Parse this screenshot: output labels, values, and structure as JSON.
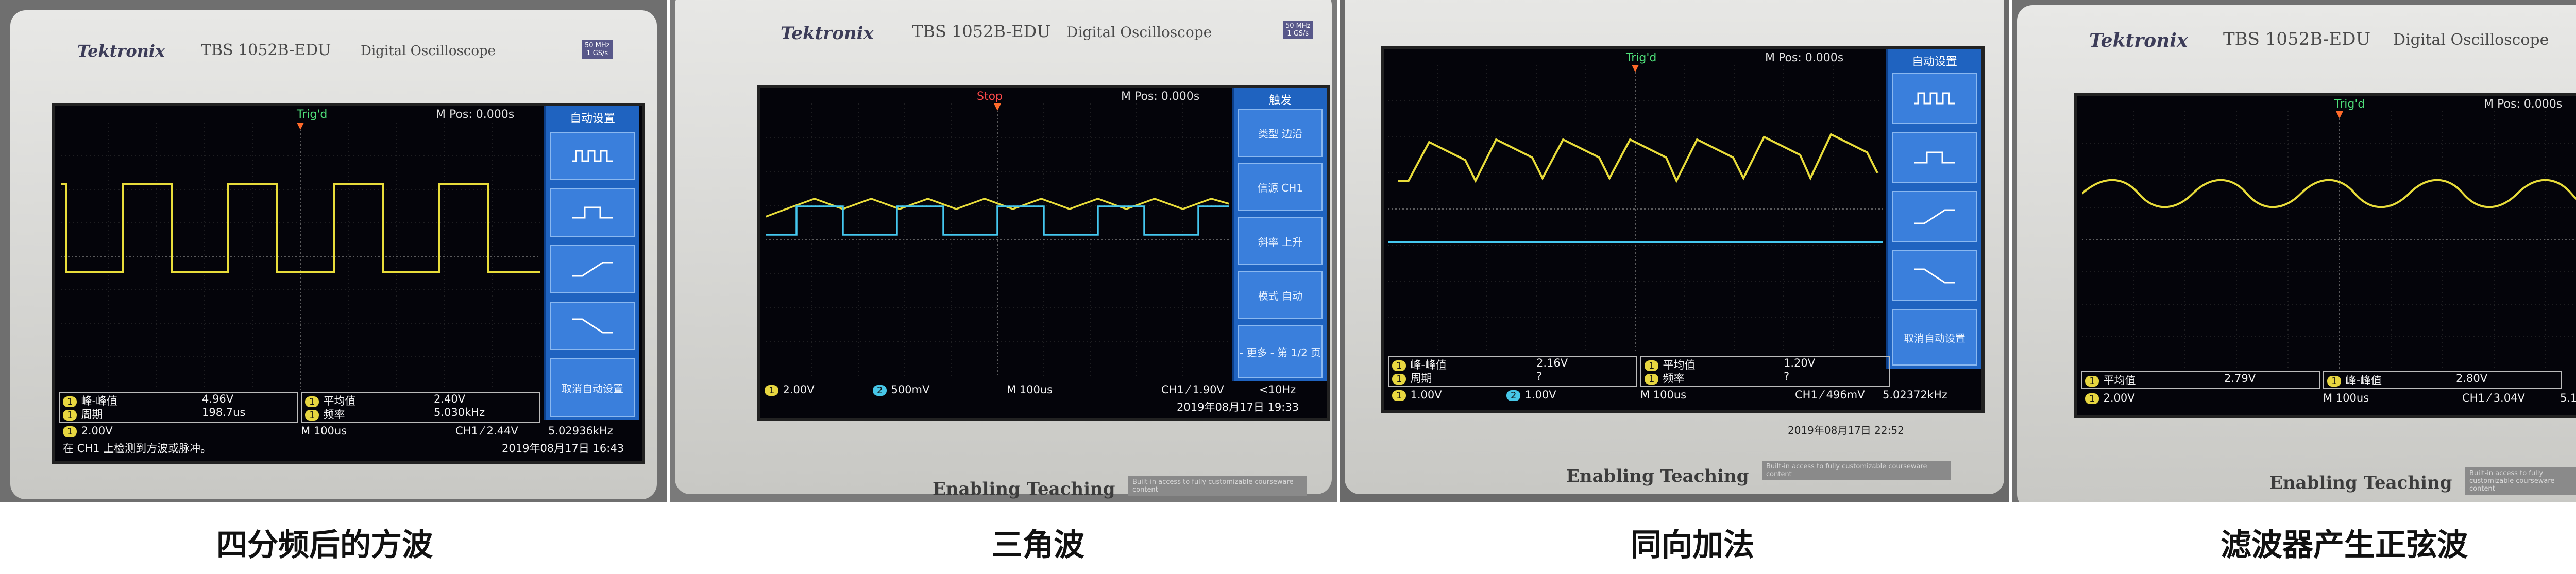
{
  "device": {
    "brand": "Tektronix",
    "model": "TBS 1052B-EDU",
    "type": "Digital Oscilloscope",
    "spec_line1": "50 MHz",
    "spec_line2": "1 GS/s",
    "teaching": "Enabling Teaching",
    "teaching_sub": "Built-in access to fully customizable courseware content"
  },
  "colors": {
    "ch1": "#e8dc3a",
    "ch2": "#45c8f0",
    "trig": "#ff6a2a",
    "menu": "#1f63c0"
  },
  "panels": [
    {
      "caption": "四分频后的方波",
      "header": {
        "trig": "Trig'd",
        "mpos": "M Pos: 0.000s"
      },
      "menu_title": "自动设置",
      "menu_items": [
        "",
        "",
        "",
        "",
        "取消自动设置"
      ],
      "menu_icons": [
        "multi-cycle-square-icon",
        "single-cycle-square-icon",
        "rising-edge-icon",
        "falling-edge-icon"
      ],
      "meas": [
        {
          "label": "峰-峰值",
          "value": "4.96V"
        },
        {
          "label": "周期",
          "value": "198.7us"
        },
        {
          "label": "平均值",
          "value": "2.40V"
        },
        {
          "label": "频率",
          "value": "5.030kHz"
        }
      ],
      "ch1_scale": "2.00V",
      "timebase": "M 100us",
      "trigger": "CH1 ⁄ 2.44V",
      "trig_freq": "5.02936kHz",
      "message": "在 CH1 上检测到方波或脉冲。",
      "datetime": "2019年08月17日 16:43"
    },
    {
      "caption": "三角波",
      "header": {
        "trig": "Stop",
        "mpos": "M Pos: 0.000s"
      },
      "menu_title": "触发",
      "menu_items": [
        "类型 边沿",
        "信源 CH1",
        "斜率 上升",
        "模式 自动",
        "- 更多 - 第 1/2 页"
      ],
      "ch1_scale": "2.00V",
      "ch2_scale": "500mV",
      "timebase": "M 100us",
      "trigger": "CH1 ⁄ 1.90V",
      "trig_freq": "<10Hz",
      "datetime": "2019年08月17日 19:33"
    },
    {
      "caption": "同向加法",
      "header": {
        "trig": "Trig'd",
        "mpos": "M Pos: 0.000s"
      },
      "menu_title": "自动设置",
      "menu_items": [
        "",
        "",
        "",
        "",
        "取消自动设置"
      ],
      "menu_icons": [
        "multi-cycle-square-icon",
        "single-cycle-square-icon",
        "rising-edge-icon",
        "falling-edge-icon"
      ],
      "meas": [
        {
          "label": "峰-峰值",
          "value": "2.16V"
        },
        {
          "label": "周期",
          "value": "?"
        },
        {
          "label": "平均值",
          "value": "1.20V"
        },
        {
          "label": "频率",
          "value": "?"
        }
      ],
      "ch1_scale": "1.00V",
      "ch2_scale": "1.00V",
      "timebase": "M 100us",
      "trigger": "CH1 ⁄ 496mV",
      "trig_freq": "5.02372kHz",
      "datetime": "2019年08月17日 22:52"
    },
    {
      "caption": "滤波器产生正弦波",
      "header": {
        "trig": "Trig'd",
        "mpos": "M Pos: 0.000s"
      },
      "meas": [
        {
          "label": "平均值",
          "value": "2.79V"
        },
        {
          "label": "峰-峰值",
          "value": "2.80V"
        }
      ],
      "ch1_scale": "2.00V",
      "timebase": "M 100us",
      "trigger": "CH1 ⁄ 3.04V",
      "trig_freq": "5.1"
    }
  ]
}
